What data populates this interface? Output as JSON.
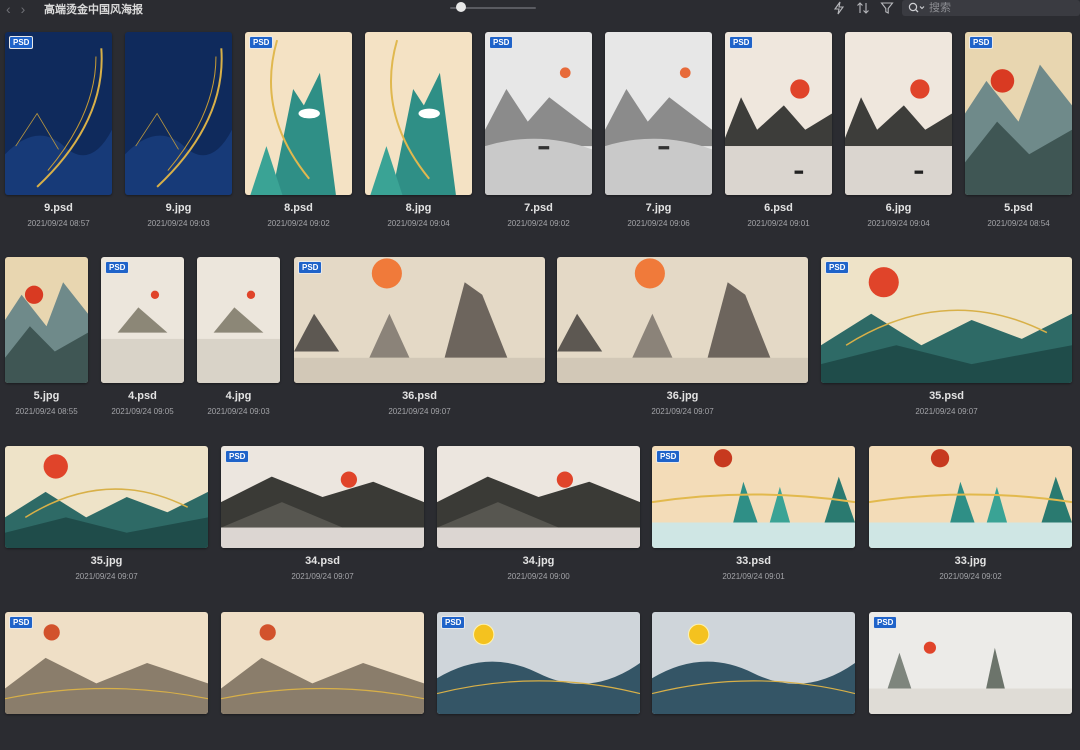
{
  "toolbar": {
    "title": "高端烫金中国风海报",
    "back_icon": "chevron-left-icon",
    "forward_icon": "chevron-right-icon",
    "zoom_level": 0.13,
    "search_placeholder": "搜索"
  },
  "files": [
    {
      "name": "9.psd",
      "date": "2021/09/24 08:57",
      "psd": true,
      "art": "navy"
    },
    {
      "name": "9.jpg",
      "date": "2021/09/24 09:03",
      "psd": false,
      "art": "navy"
    },
    {
      "name": "8.psd",
      "date": "2021/09/24 09:02",
      "psd": true,
      "art": "gold"
    },
    {
      "name": "8.jpg",
      "date": "2021/09/24 09:04",
      "psd": false,
      "art": "gold"
    },
    {
      "name": "7.psd",
      "date": "2021/09/24 09:02",
      "psd": true,
      "art": "grey"
    },
    {
      "name": "7.jpg",
      "date": "2021/09/24 09:06",
      "psd": false,
      "art": "grey"
    },
    {
      "name": "6.psd",
      "date": "2021/09/24 09:01",
      "psd": true,
      "art": "ink"
    },
    {
      "name": "6.jpg",
      "date": "2021/09/24 09:04",
      "psd": false,
      "art": "ink"
    },
    {
      "name": "5.psd",
      "date": "2021/09/24 08:54",
      "psd": true,
      "art": "teal"
    },
    {
      "name": "5.jpg",
      "date": "2021/09/24 08:55",
      "psd": false,
      "art": "teal"
    },
    {
      "name": "4.psd",
      "date": "2021/09/24 09:05",
      "psd": true,
      "art": "pale"
    },
    {
      "name": "4.jpg",
      "date": "2021/09/24 09:03",
      "psd": false,
      "art": "pale"
    },
    {
      "name": "36.psd",
      "date": "2021/09/24 09:07",
      "psd": true,
      "art": "beige"
    },
    {
      "name": "36.jpg",
      "date": "2021/09/24 09:07",
      "psd": false,
      "art": "beige"
    },
    {
      "name": "35.psd",
      "date": "2021/09/24 09:07",
      "psd": true,
      "art": "green"
    },
    {
      "name": "35.jpg",
      "date": "2021/09/24 09:07",
      "psd": false,
      "art": "green"
    },
    {
      "name": "34.psd",
      "date": "2021/09/24 09:07",
      "psd": true,
      "art": "dark"
    },
    {
      "name": "34.jpg",
      "date": "2021/09/24 09:00",
      "psd": false,
      "art": "dark"
    },
    {
      "name": "33.psd",
      "date": "2021/09/24 09:01",
      "psd": true,
      "art": "peach"
    },
    {
      "name": "33.jpg",
      "date": "2021/09/24 09:02",
      "psd": false,
      "art": "peach"
    },
    {
      "name": "",
      "date": "",
      "psd": true,
      "art": "sand"
    },
    {
      "name": "",
      "date": "",
      "psd": false,
      "art": "sand"
    },
    {
      "name": "",
      "date": "",
      "psd": true,
      "art": "moon"
    },
    {
      "name": "",
      "date": "",
      "psd": false,
      "art": "moon"
    },
    {
      "name": "",
      "date": "",
      "psd": true,
      "art": "mist"
    }
  ],
  "badge_label": "PSD",
  "colors": {
    "background": "#2b2c31",
    "badge": "#1f63c9",
    "sun_red": "#e0442a",
    "gold": "#d9b24a"
  }
}
